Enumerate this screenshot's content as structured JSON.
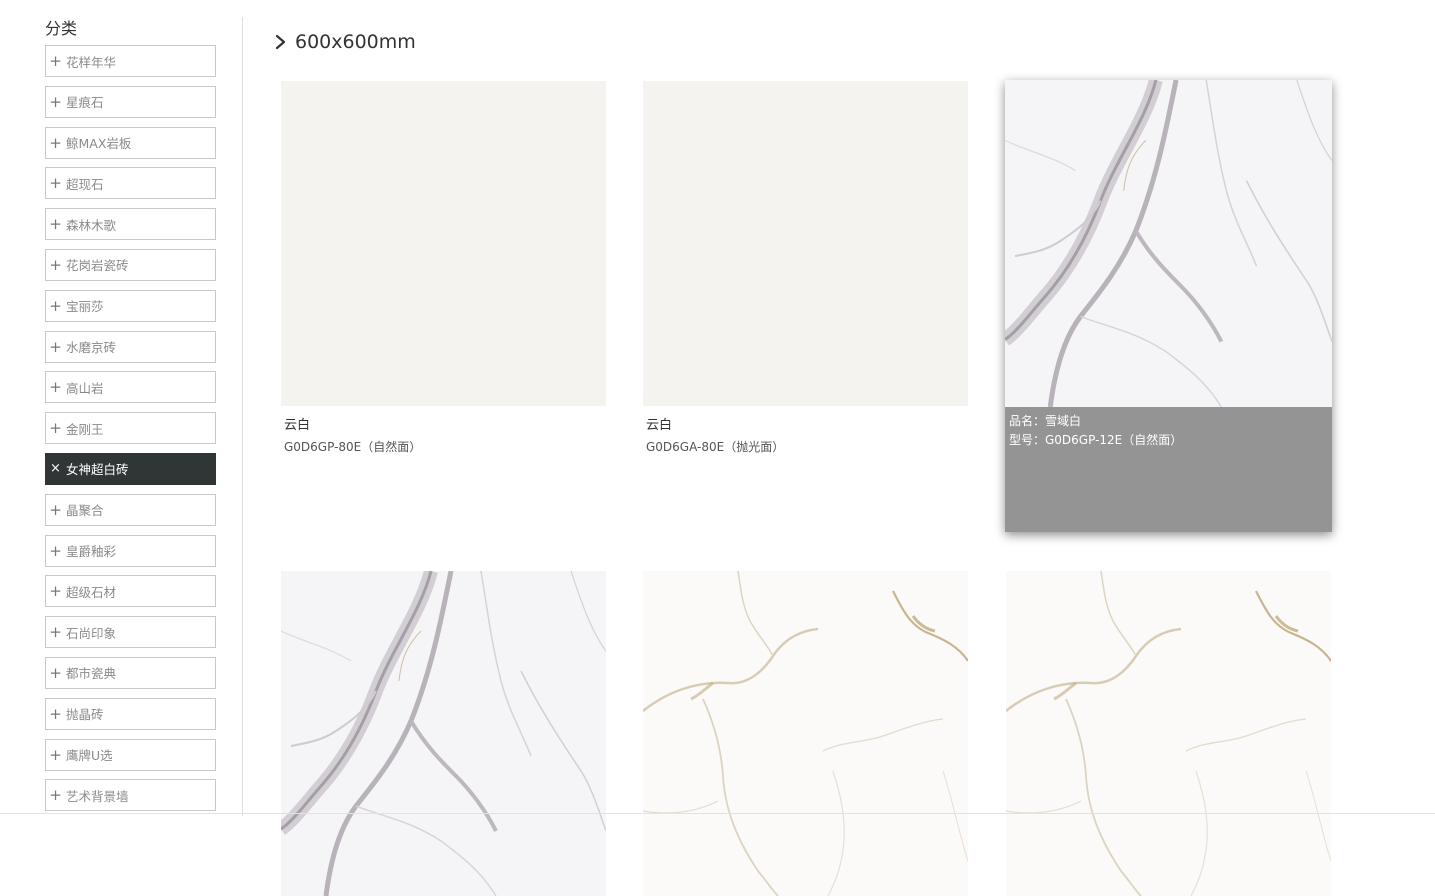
{
  "sidebar": {
    "title": "分类",
    "items": [
      {
        "label": "花样年华",
        "mark": "+"
      },
      {
        "label": "星痕石",
        "mark": "+"
      },
      {
        "label": "鲸MAX岩板",
        "mark": "+"
      },
      {
        "label": "超现石",
        "mark": "+"
      },
      {
        "label": "森林木歌",
        "mark": "+"
      },
      {
        "label": "花岗岩瓷砖",
        "mark": "+"
      },
      {
        "label": "宝丽莎",
        "mark": "+"
      },
      {
        "label": "水磨京砖",
        "mark": "+"
      },
      {
        "label": "高山岩",
        "mark": "+"
      },
      {
        "label": "金刚王",
        "mark": "+"
      },
      {
        "label": "女神超白砖",
        "mark": "×",
        "active": true
      },
      {
        "label": "晶聚合",
        "mark": "+"
      },
      {
        "label": "皇爵釉彩",
        "mark": "+"
      },
      {
        "label": "超级石材",
        "mark": "+"
      },
      {
        "label": "石尚印象",
        "mark": "+"
      },
      {
        "label": "都市瓷典",
        "mark": "+"
      },
      {
        "label": "抛晶砖",
        "mark": "+"
      },
      {
        "label": "鹰牌U选",
        "mark": "+"
      },
      {
        "label": "艺术背景墙",
        "mark": "+"
      }
    ]
  },
  "main": {
    "heading": "600x600mm",
    "heading_icon": "chevron-right-icon",
    "products": [
      {
        "name": "云白",
        "model": "G0D6GP-80E（自然面）",
        "texture": "plain-warm-white"
      },
      {
        "name": "云白",
        "model": "G0D6GA-80E（抛光面）",
        "texture": "plain-warm-white"
      },
      {
        "name_line": "品名：雪域白",
        "model_line": "型号：G0D6GP-12E（自然面）",
        "texture": "grey-vein-marble",
        "hovered": true
      },
      {
        "texture": "grey-vein-marble"
      },
      {
        "texture": "gold-vein-marble"
      },
      {
        "texture": "gold-vein-marble"
      }
    ]
  },
  "colors": {
    "active_item_bg": "#303536",
    "overlay_bg": "#949494",
    "plain_tile": "#f4f3f0",
    "border": "#c9c9c9"
  }
}
